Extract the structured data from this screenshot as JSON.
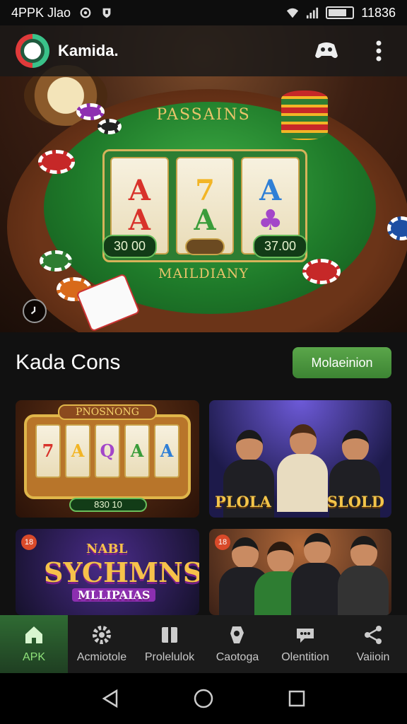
{
  "status_bar": {
    "left_text": "4PPK Jlao",
    "time": "11836",
    "icons": [
      "sync-icon",
      "shield-icon",
      "wifi-icon",
      "signal-icon",
      "battery-icon"
    ]
  },
  "app_bar": {
    "title": "Kamida.",
    "logo_icon": "app-logo",
    "action_icons": [
      "gamepad-icon",
      "more-vertical-icon"
    ]
  },
  "hero": {
    "felt_title": "PASSAINS",
    "felt_subtitle": "MAILDIANY",
    "reels": [
      [
        "A",
        "A"
      ],
      [
        "7",
        "A"
      ],
      [
        "A",
        "♣"
      ]
    ],
    "left_display": "30 00",
    "right_display": "37.00",
    "corner_icon": "clock-icon"
  },
  "section": {
    "title": "Kada Cons",
    "button_label": "Molaeinion"
  },
  "cards": [
    {
      "banner": "PNOSNONG",
      "amount": "830 10",
      "reels": [
        "7",
        "A",
        "Q",
        "A",
        "A"
      ]
    },
    {
      "label_left": "PLOLA",
      "label_right": "SLOLD"
    },
    {
      "badge": "18",
      "logo_line1": "NABL",
      "logo_line2": "SYCHMNS",
      "logo_line3": "MLLIPAIAS"
    },
    {
      "badge": "18"
    }
  ],
  "bottom_nav": [
    {
      "label": "APK",
      "icon": "home-icon",
      "active": true
    },
    {
      "label": "Acmiotolе",
      "icon": "gear-icon",
      "active": false
    },
    {
      "label": "Prolelulok",
      "icon": "book-icon",
      "active": false
    },
    {
      "label": "Caotoga",
      "icon": "chip-icon",
      "active": false
    },
    {
      "label": "Olentition",
      "icon": "chat-icon",
      "active": false
    },
    {
      "label": "Vaiioin",
      "icon": "share-icon",
      "active": false
    }
  ],
  "system_nav": [
    "back-icon",
    "home-circle-icon",
    "recents-icon"
  ],
  "colors": {
    "accent_green": "#4f9a42",
    "felt_green": "#1f7b2a",
    "gold": "#e9c46a"
  }
}
